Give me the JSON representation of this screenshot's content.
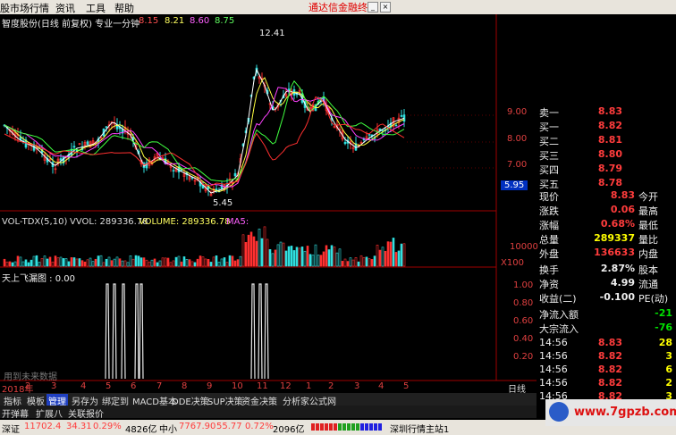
{
  "menu": {
    "items": [
      "股市场行情",
      "资讯",
      "工具",
      "帮助"
    ],
    "brand": "通达信金融终端"
  },
  "chart": {
    "title": "智度股份(日线 前复权) 专业一分钟",
    "ma_values": [
      "8.15",
      "8.21",
      "8.60",
      "8.75"
    ],
    "high_label": "12.41",
    "low_label": "5.45",
    "price_axis": [
      "9.00",
      "8.00",
      "7.00"
    ],
    "price_marker": "5.95",
    "vol_title": "VOL-TDX(5,10)",
    "vol_vvol": "VVOL: 289336.78",
    "vol_volume": "VOLUME: 289336.78",
    "vol_ma": "MA5:",
    "vol_axis": "10000",
    "vol_unit": "X100",
    "ind_title": "天上飞漏图 : 0.00",
    "ind_axis": [
      "1.00",
      "0.80",
      "0.60",
      "0.40",
      "0.20"
    ],
    "ind_note": "用到未来数据",
    "time_labels": [
      "2018年",
      "2",
      "3",
      "4",
      "5",
      "6",
      "7",
      "8",
      "9",
      "10",
      "11",
      "12",
      "1",
      "2",
      "3",
      "4",
      "5"
    ],
    "period": "日线"
  },
  "quote": {
    "sell1": {
      "label": "卖一",
      "price": "8.83"
    },
    "buys": [
      {
        "label": "买一",
        "price": "8.82"
      },
      {
        "label": "买二",
        "price": "8.81"
      },
      {
        "label": "买三",
        "price": "8.80"
      },
      {
        "label": "买四",
        "price": "8.79"
      },
      {
        "label": "买五",
        "price": "8.78"
      }
    ],
    "stats": [
      {
        "label": "现价",
        "value": "8.83",
        "label2": "今开"
      },
      {
        "label": "涨跌",
        "value": "0.06",
        "label2": "最高"
      },
      {
        "label": "涨幅",
        "value": "0.68%",
        "label2": "最低"
      },
      {
        "label": "总量",
        "value": "289337",
        "label2": "量比"
      },
      {
        "label": "外盘",
        "value": "136633",
        "label2": "内盘"
      },
      {
        "label": "换手",
        "value": "2.87%",
        "label2": "股本"
      },
      {
        "label": "净资",
        "value": "4.99",
        "label2": "流通"
      },
      {
        "label": "收益(二)",
        "value": "-0.100",
        "label2": "PE(动)"
      }
    ],
    "flows": [
      {
        "label": "净流入额",
        "value": "-21"
      },
      {
        "label": "大宗流入",
        "value": "-76"
      }
    ],
    "ticks": [
      {
        "time": "14:56",
        "price": "8.83",
        "vol": "28"
      },
      {
        "time": "14:56",
        "price": "8.82",
        "vol": "3"
      },
      {
        "time": "14:56",
        "price": "8.82",
        "vol": "6"
      },
      {
        "time": "14:56",
        "price": "8.82",
        "vol": "2"
      },
      {
        "time": "14:56",
        "price": "8.82",
        "vol": "3"
      }
    ]
  },
  "tabs": [
    "指标",
    "模板",
    "管理",
    "另存为",
    "绑定到",
    "MACD基本",
    "DDE决策",
    "SUP决策",
    "资金决策",
    "分析家公式网"
  ],
  "tabs_active": "管理",
  "subtabs": [
    "开弹幕",
    "扩展八",
    "关联报价"
  ],
  "status": {
    "sz_name": "深证",
    "sz_value": "11702.4",
    "sz_change": "34.31",
    "sz_pct": "0.29%",
    "sz_amount": "4826亿",
    "sm_name": "中小",
    "sm_value": "7767.90",
    "sm_change": "55.77",
    "sm_pct": "0.72%",
    "sm_amount": "2096亿",
    "station": "深圳行情主站1"
  },
  "watermark": "www.7gpzb.com"
}
